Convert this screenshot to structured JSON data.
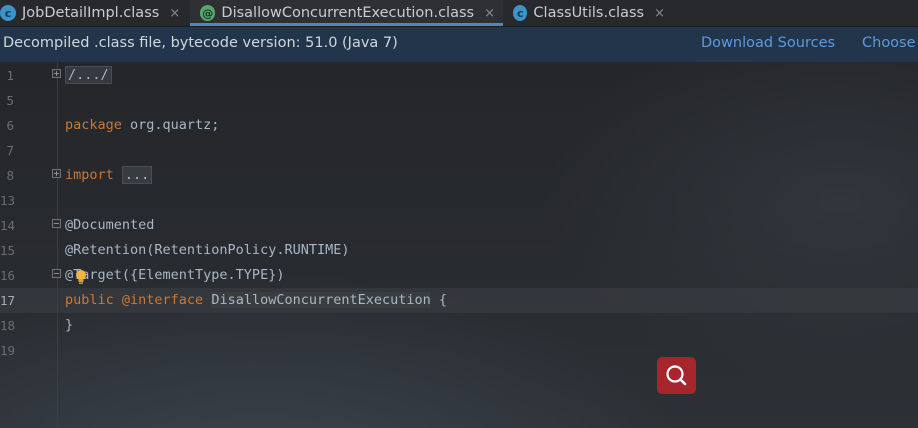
{
  "tabs": [
    {
      "label": "JobDetailImpl.class",
      "icon": "class-icon",
      "glyph": "c",
      "close": "×",
      "active": false
    },
    {
      "label": "DisallowConcurrentExecution.class",
      "icon": "annotation-icon",
      "glyph": "@",
      "close": "×",
      "active": true
    },
    {
      "label": "ClassUtils.class",
      "icon": "class-icon",
      "glyph": "c",
      "close": "×",
      "active": false
    }
  ],
  "banner": {
    "message": "Decompiled .class file, bytecode version: 51.0 (Java 7)",
    "download_sources": "Download Sources",
    "choose_sources": "Choose"
  },
  "editor": {
    "lines": [
      {
        "num": "1",
        "fold": "plus",
        "code": "/.../"
      },
      {
        "num": "5"
      },
      {
        "num": "6",
        "code_kw": "package",
        "code_rest": " org.quartz;"
      },
      {
        "num": "7"
      },
      {
        "num": "8",
        "fold": "plus",
        "code_kw": "import",
        "code_folded": "..."
      },
      {
        "num": "13"
      },
      {
        "num": "14",
        "fold": "minus",
        "code": "@Documented"
      },
      {
        "num": "15",
        "code": "@Retention(RetentionPolicy.RUNTIME)"
      },
      {
        "num": "16",
        "fold": "minus",
        "code": "@Target({ElementType.TYPE})"
      },
      {
        "num": "17",
        "current": true,
        "code_kw": "public",
        "code_at": " @interface",
        "code_name": "DisallowConcurrentExecution",
        "code_tail": " {"
      },
      {
        "num": "18",
        "fold": "end",
        "code": "}"
      },
      {
        "num": "19"
      }
    ]
  },
  "colors": {
    "keyword": "#cc7832",
    "text": "#a9b7c6",
    "link": "#5a9be0",
    "tab_accent": "#4a88c7",
    "search_button": "#a5262c"
  },
  "icons": {
    "intention_bulb": "lightbulb-icon",
    "search": "search-icon"
  }
}
